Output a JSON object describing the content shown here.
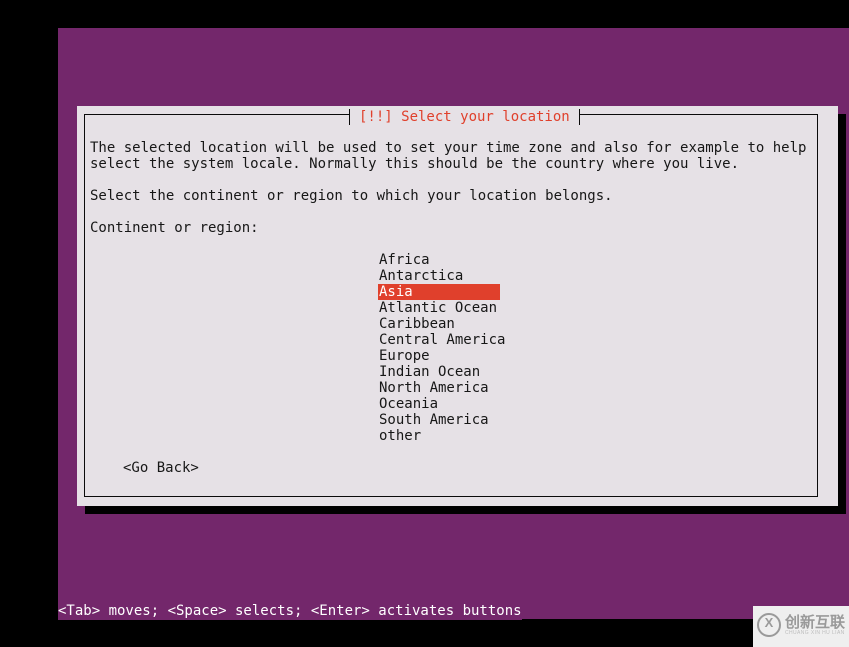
{
  "colors": {
    "terminal_bg": "#73276b",
    "dialog_bg": "#e6e1e6",
    "dialog_border": "#0b0b0b",
    "title_fg": "#e0402c",
    "highlight_bg": "#e0402c",
    "highlight_fg": "#ffffff",
    "text_fg": "#171717",
    "status_fg": "#ffffff",
    "screen_bg": "#000000"
  },
  "dialog": {
    "title": "[!!] Select your location",
    "paragraph_1_line_1": "The selected location will be used to set your time zone and also for example to help",
    "paragraph_1_line_2": "select the system locale. Normally this should be the country where you live.",
    "paragraph_2": "Select the continent or region to which your location belongs.",
    "field_label": "Continent or region:",
    "list": {
      "selected_index": 2,
      "items": [
        "Africa",
        "Antarctica",
        "Asia",
        "Atlantic Ocean",
        "Caribbean",
        "Central America",
        "Europe",
        "Indian Ocean",
        "North America",
        "Oceania",
        "South America",
        "other"
      ]
    },
    "buttons": {
      "go_back": "<Go Back>"
    }
  },
  "status_bar": {
    "hint": "<Tab> moves; <Space> selects; <Enter> activates buttons"
  },
  "watermark": {
    "mark": "X",
    "chinese": "创新互联",
    "pinyin": "CHUANG XIN HU LIAN"
  }
}
